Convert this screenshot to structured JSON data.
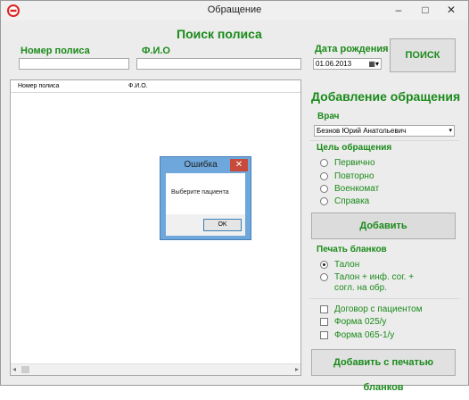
{
  "window": {
    "title": "Обращение",
    "minimize": "–",
    "maximize": "□",
    "close": "✕"
  },
  "search": {
    "heading": "Поиск полиса",
    "policy_label": "Номер полиса",
    "policy_value": "",
    "fio_label": "Ф.И.О",
    "fio_value": "",
    "birth_label": "Дата рождения",
    "birth_value": "01.06.2013",
    "search_button": "ПОИСК"
  },
  "grid": {
    "columns": [
      "Номер полиса",
      "Ф.И.О."
    ]
  },
  "add": {
    "heading": "Добавление обращения",
    "doctor_label": "Врач",
    "doctor_value": "Безнов Юрий Анатольевич",
    "purpose_label": "Цель обращения",
    "purposes": [
      {
        "label": "Первично",
        "checked": false
      },
      {
        "label": "Повторно",
        "checked": false
      },
      {
        "label": "Военкомат",
        "checked": false
      },
      {
        "label": "Справка",
        "checked": false
      }
    ],
    "add_button": "Добавить",
    "print_label": "Печать бланков",
    "print_options": [
      {
        "label": "Талон",
        "checked": true
      },
      {
        "label": "Талон + инф. сог. + согл. на обр.",
        "checked": false
      }
    ],
    "checks": [
      {
        "label": "Договор с пациентом"
      },
      {
        "label": "Форма 025/у"
      },
      {
        "label": "Форма 065-1/у"
      }
    ],
    "add_print_button": "Добавить с печатью бланков"
  },
  "dialog": {
    "title": "Ошибка",
    "message": "Выберите пациента",
    "ok": "OK",
    "close": "✕"
  },
  "colors": {
    "accent": "#1a8a1a",
    "dialog_frame": "#6ea7dc",
    "close_red": "#c74a3a"
  }
}
